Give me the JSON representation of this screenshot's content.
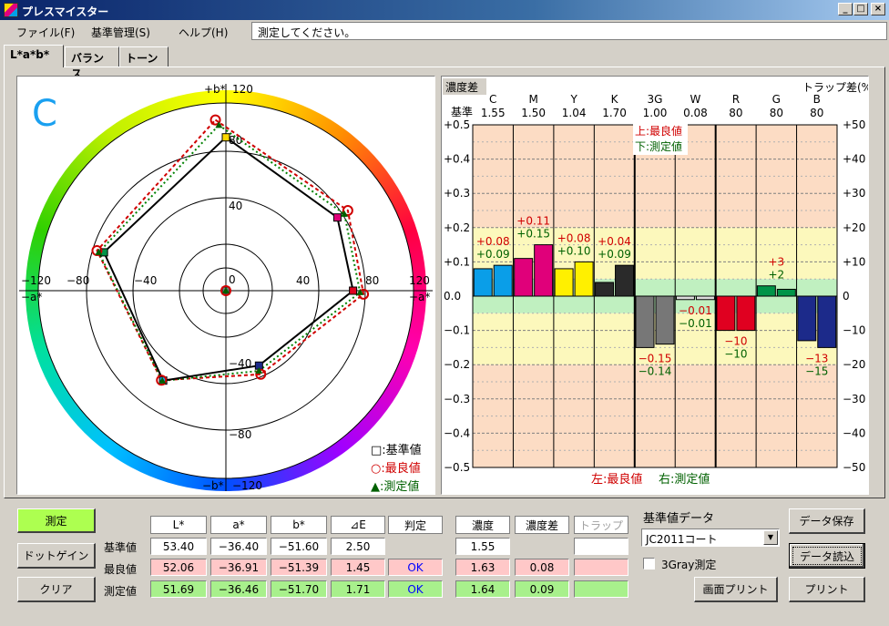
{
  "window": {
    "title": "プレスマイスター",
    "minimize": "_",
    "maximize": "□",
    "close": "×"
  },
  "menu": {
    "file": "ファイル(F)",
    "standards": "基準管理(S)",
    "help": "ヘルプ(H)"
  },
  "status_message": "測定してください。",
  "tabs": [
    "L*a*b*",
    "バランス",
    "トーン"
  ],
  "polar": {
    "ink": "C",
    "ink_color": "#1aa0f0",
    "axis_b_pos": "+b*",
    "axis_b_neg": "−b*",
    "axis_a_pos": "+a*",
    "axis_a_neg": "−a*",
    "tick_120": "120",
    "tick_m120": "−120",
    "rings": [
      "0",
      "40",
      "80"
    ],
    "b_ticks": [
      "80",
      "40",
      "0",
      "−40",
      "−80"
    ],
    "a_ticks": [
      "−80",
      "−40",
      "0",
      "40",
      "80"
    ],
    "legend": {
      "standard": "□:基準値",
      "best": "○:最良値",
      "measured": "▲:測定値"
    },
    "standard_points": [
      [
        0,
        88
      ],
      [
        64,
        42
      ],
      [
        73,
        0
      ],
      [
        19,
        -43
      ],
      [
        -36,
        -51.6
      ],
      [
        -70,
        22
      ],
      [
        0,
        0
      ]
    ],
    "best_points": [
      [
        -6,
        98
      ],
      [
        70,
        46
      ],
      [
        79,
        -2
      ],
      [
        20,
        -48
      ],
      [
        -37,
        -51.4
      ],
      [
        -74,
        23
      ],
      [
        0,
        0
      ]
    ],
    "measured_points": [
      [
        -4,
        95
      ],
      [
        68,
        44
      ],
      [
        77,
        -1
      ],
      [
        19,
        -46
      ],
      [
        -36.5,
        -51.7
      ],
      [
        -73,
        22
      ],
      [
        0,
        0
      ]
    ]
  },
  "bars": {
    "title": "濃度差",
    "right_title": "トラップ差(%)",
    "base_label": "基準",
    "annotation_top": "上:最良値",
    "annotation_bottom": "下:測定値",
    "footer_left": "左:最良値",
    "footer_right": "右:測定値",
    "left_ticks": [
      "+0.5",
      "+0.4",
      "+0.3",
      "+0.2",
      "+0.1",
      "0.0",
      "−0.1",
      "−0.2",
      "−0.3",
      "−0.4",
      "−0.5"
    ],
    "right_ticks": [
      "+50",
      "+40",
      "+30",
      "+20",
      "+10",
      "0",
      "−10",
      "−20",
      "−30",
      "−40",
      "−50"
    ]
  },
  "chart_data": {
    "type": "bar",
    "categories": [
      "C",
      "M",
      "Y",
      "K",
      "3G",
      "W",
      "R",
      "G",
      "B"
    ],
    "base_values": [
      "1.55",
      "1.50",
      "1.04",
      "1.70",
      "1.00",
      "0.08",
      "80",
      "80",
      "80"
    ],
    "series": [
      {
        "name": "最良値",
        "values": [
          0.08,
          0.11,
          0.08,
          0.04,
          -0.15,
          -0.01,
          -10,
          3,
          -13
        ],
        "labels": [
          "+0.08",
          "+0.11",
          "+0.08",
          "+0.04",
          "−0.15",
          "−0.01",
          "−10",
          "+3",
          "−13"
        ]
      },
      {
        "name": "測定値",
        "values": [
          0.09,
          0.15,
          0.1,
          0.09,
          -0.14,
          -0.01,
          -10,
          2,
          -15
        ],
        "labels": [
          "+0.09",
          "+0.15",
          "+0.10",
          "+0.09",
          "−0.14",
          "−0.01",
          "−10",
          "+2",
          "−15"
        ]
      }
    ],
    "colors": [
      "#0a9ee8",
      "#e0007a",
      "#fff000",
      "#2a2a2a",
      "#777777",
      "#dddddd",
      "#e00020",
      "#009448",
      "#1c2a8a"
    ],
    "ylim": [
      -0.5,
      0.5
    ],
    "y2lim": [
      -50,
      50
    ]
  },
  "controls": {
    "measure": "測定",
    "dot_gain": "ドットゲイン",
    "clear": "クリア",
    "standard_data_label": "基準値データ",
    "standard_data_value": "JC2011コート",
    "three_gray": "3Gray測定",
    "save_data": "データ保存",
    "load_data": "データ読込",
    "screen_print": "画面プリント",
    "print": "プリント"
  },
  "table": {
    "headers": [
      "L*",
      "a*",
      "b*",
      "⊿E",
      "判定",
      "濃度",
      "濃度差",
      "トラップ"
    ],
    "row_labels": [
      "基準値",
      "最良値",
      "測定値"
    ],
    "standard": [
      "53.40",
      "−36.40",
      "−51.60",
      "2.50",
      "",
      "1.55",
      "",
      ""
    ],
    "best": [
      "52.06",
      "−36.91",
      "−51.39",
      "1.45",
      "OK",
      "1.63",
      "0.08",
      ""
    ],
    "measured": [
      "51.69",
      "−36.46",
      "−51.70",
      "1.71",
      "OK",
      "1.64",
      "0.09",
      ""
    ]
  }
}
